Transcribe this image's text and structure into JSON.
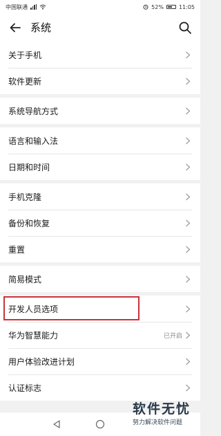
{
  "status_bar": {
    "carrier": "中国联通",
    "battery_percent": "52%",
    "time": "11:05"
  },
  "header": {
    "title": "系统",
    "back_icon": "back-arrow-icon",
    "search_icon": "search-icon"
  },
  "groups": [
    {
      "items": [
        {
          "label": "关于手机"
        },
        {
          "label": "软件更新"
        }
      ]
    },
    {
      "items": [
        {
          "label": "系统导航方式"
        }
      ]
    },
    {
      "items": [
        {
          "label": "语言和输入法"
        },
        {
          "label": "日期和时间"
        }
      ]
    },
    {
      "items": [
        {
          "label": "手机克隆"
        },
        {
          "label": "备份和恢复"
        },
        {
          "label": "重置"
        }
      ]
    },
    {
      "items": [
        {
          "label": "简易模式"
        }
      ]
    },
    {
      "items": [
        {
          "label": "开发人员选项",
          "highlighted": true
        },
        {
          "label": "华为智慧能力",
          "value": "已开启"
        },
        {
          "label": "用户体验改进计划"
        },
        {
          "label": "认证标志"
        }
      ]
    }
  ],
  "highlight_color": "#c8323c",
  "nav_bar": {
    "back_icon": "triangle-back-icon",
    "home_icon": "circle-home-icon"
  },
  "watermark": {
    "title": "软件无忧",
    "subtitle": "努力解决软件问题"
  }
}
